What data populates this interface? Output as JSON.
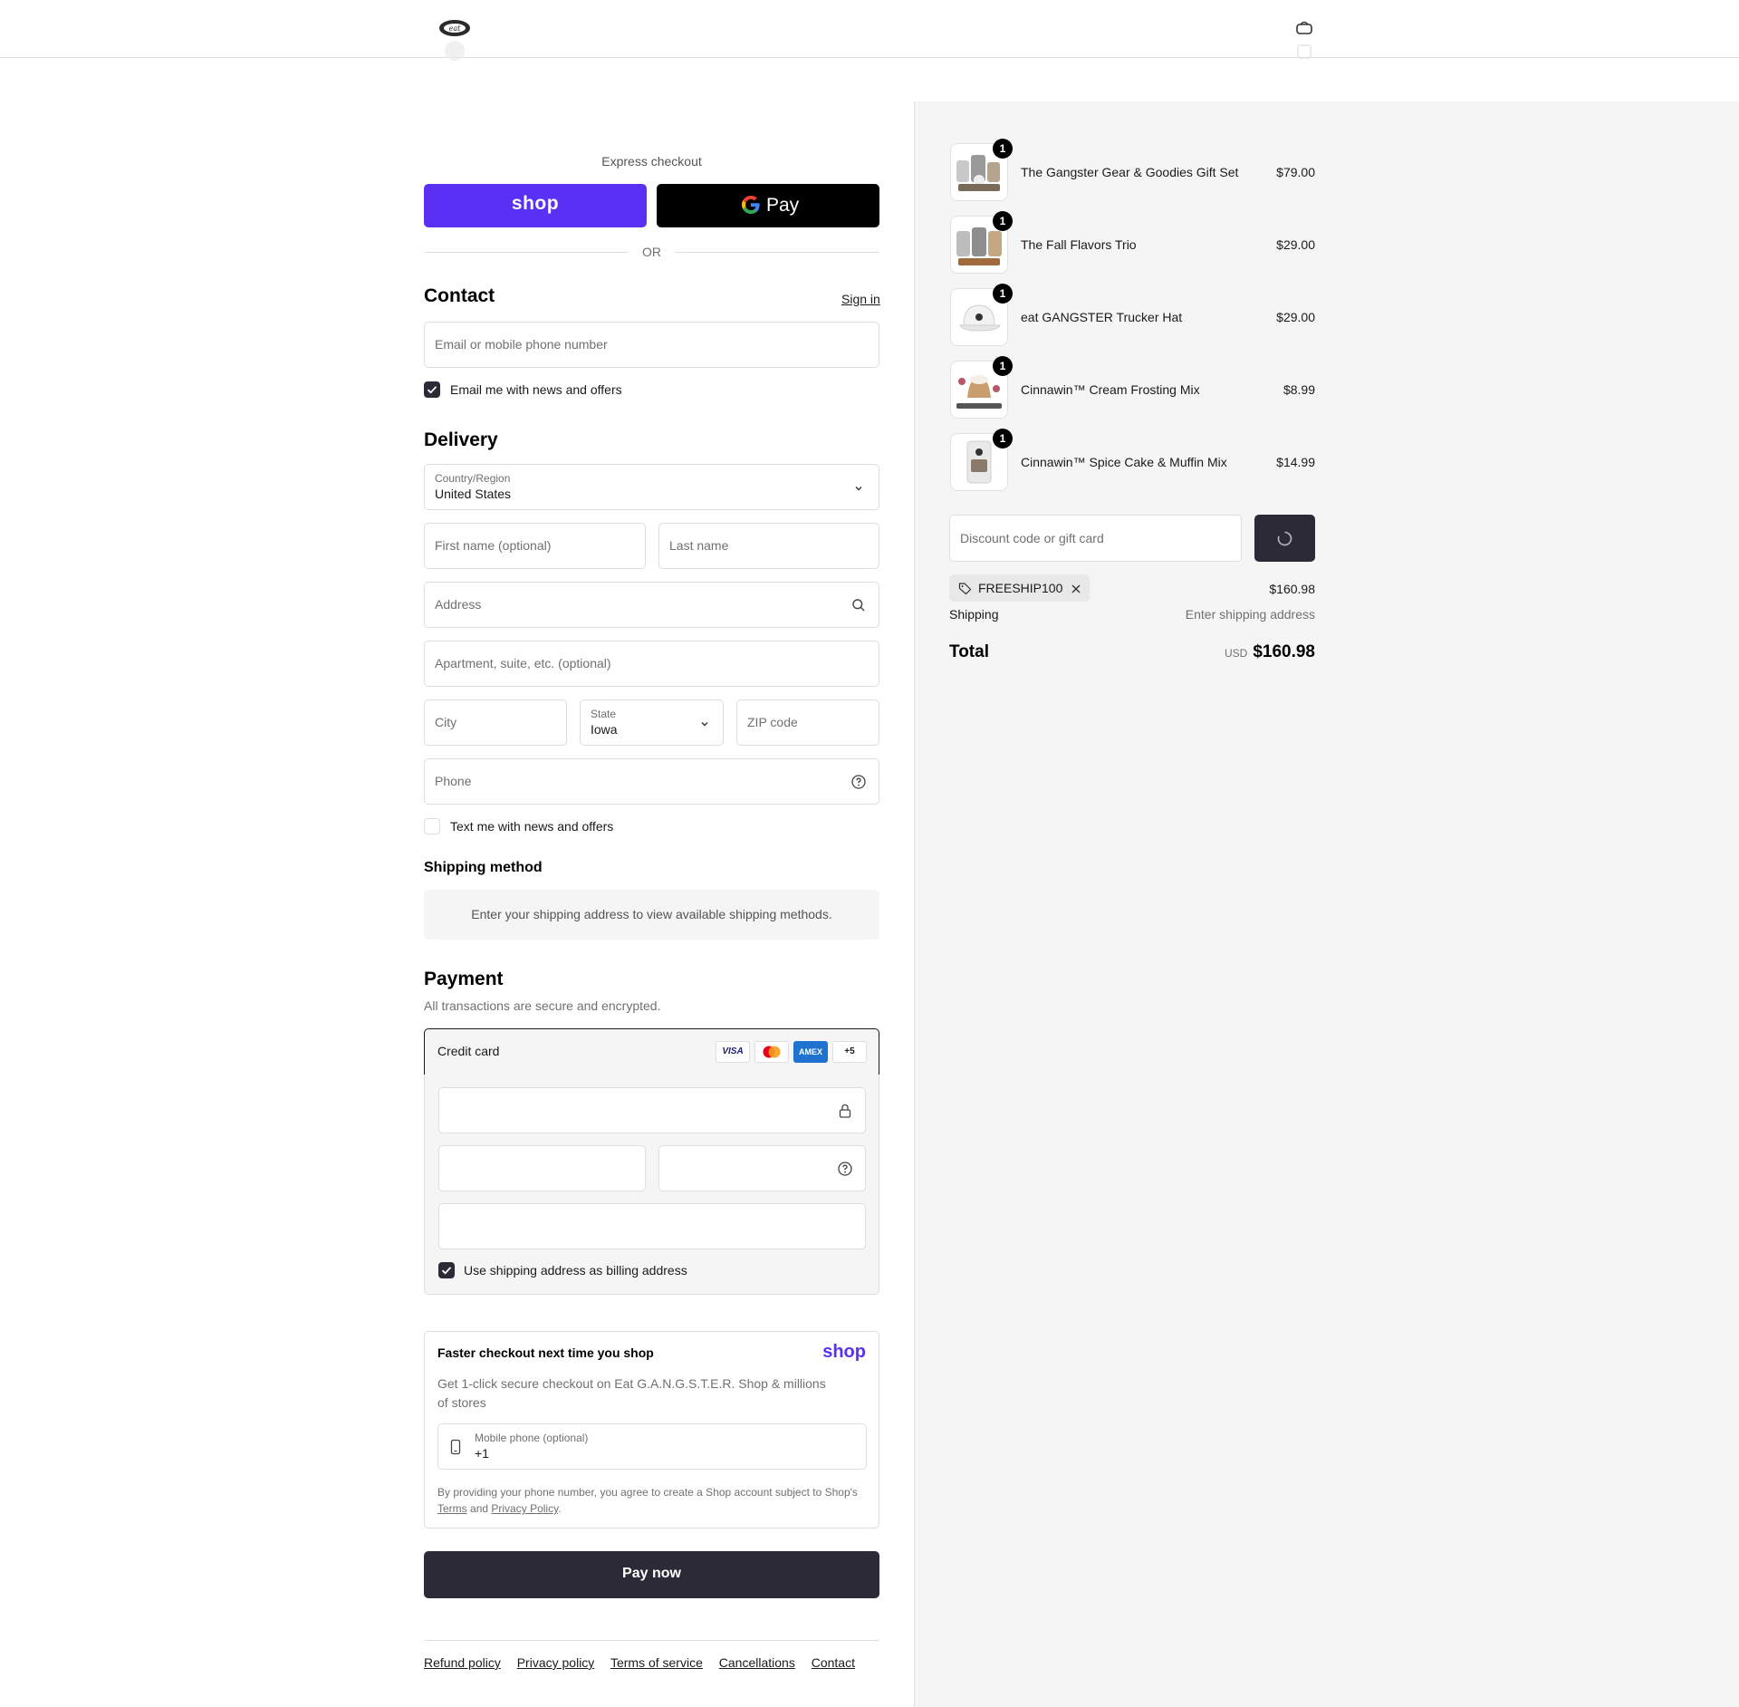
{
  "express": {
    "title": "Express checkout",
    "shop_label": "shop",
    "gpay_label": "Pay",
    "or": "OR"
  },
  "contact": {
    "heading": "Contact",
    "sign_in": "Sign in",
    "email_placeholder": "Email or mobile phone number",
    "news_label": "Email me with news and offers",
    "news_checked": true
  },
  "delivery": {
    "heading": "Delivery",
    "country_label": "Country/Region",
    "country_value": "United States",
    "first_name_placeholder": "First name (optional)",
    "last_name_placeholder": "Last name",
    "address_placeholder": "Address",
    "apartment_placeholder": "Apartment, suite, etc. (optional)",
    "city_placeholder": "City",
    "state_label": "State",
    "state_value": "Iowa",
    "zip_placeholder": "ZIP code",
    "phone_placeholder": "Phone",
    "text_label": "Text me with news and offers",
    "text_checked": false
  },
  "shipping_method": {
    "heading": "Shipping method",
    "message": "Enter your shipping address to view available shipping methods."
  },
  "payment": {
    "heading": "Payment",
    "subtitle": "All transactions are secure and encrypted.",
    "credit_card_label": "Credit card",
    "cards": [
      "VISA",
      "MC",
      "AMEX",
      "+5"
    ],
    "billing_label": "Use shipping address as billing address",
    "billing_checked": true
  },
  "shop_pay": {
    "title": "Faster checkout next time you shop",
    "logo": "shop",
    "description": "Get 1-click secure checkout on Eat G.A.N.G.S.T.E.R. Shop & millions of stores",
    "phone_label": "Mobile phone (optional)",
    "phone_value": "+1",
    "legal_prefix": "By providing your phone number, you agree to create a Shop account subject to Shop's",
    "terms": "Terms",
    "and": "and",
    "privacy": "Privacy Policy",
    "period": "."
  },
  "pay_now": "Pay now",
  "footer_links": [
    "Refund policy",
    "Privacy policy",
    "Terms of service",
    "Cancellations",
    "Contact"
  ],
  "cart": {
    "items": [
      {
        "name": "The Gangster Gear & Goodies Gift Set",
        "price": "$79.00",
        "qty": "1"
      },
      {
        "name": "The Fall Flavors Trio",
        "price": "$29.00",
        "qty": "1"
      },
      {
        "name": "eat GANGSTER Trucker Hat",
        "price": "$29.00",
        "qty": "1"
      },
      {
        "name": "Cinnawin™ Cream Frosting Mix",
        "price": "$8.99",
        "qty": "1"
      },
      {
        "name": "Cinnawin™ Spice Cake & Muffin Mix",
        "price": "$14.99",
        "qty": "1"
      }
    ],
    "discount_placeholder": "Discount code or gift card",
    "discount_code": "FREESHIP100",
    "subtotal": "$160.98",
    "shipping_label": "Shipping",
    "shipping_value": "Enter shipping address",
    "total_label": "Total",
    "currency": "USD",
    "total": "$160.98"
  },
  "colors": {
    "shop_purple": "#5a31f4",
    "primary_dark": "#2d2a37",
    "right_bg": "#f5f5f5"
  }
}
